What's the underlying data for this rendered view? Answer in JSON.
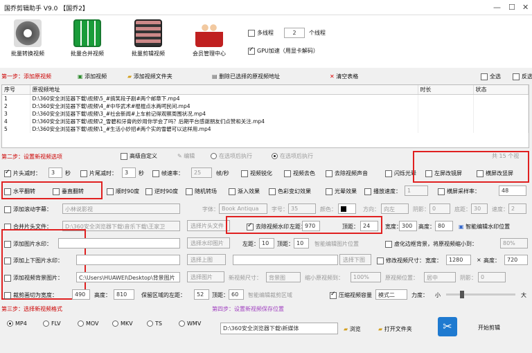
{
  "window": {
    "title": "国乔剪辑助手 V9.0 【国乔2】"
  },
  "toolbar": {
    "tools": [
      {
        "label": "批量转换视频"
      },
      {
        "label": "批量合并视频"
      },
      {
        "label": "批量剪辑视频"
      },
      {
        "label": "会员管理中心"
      }
    ],
    "multithread_label": "多线程",
    "thread_count": "2",
    "thread_unit": "个线程",
    "gpu_label": "GPU加速（用显卡解码）"
  },
  "step1": {
    "label": "第一步：添加原视频",
    "add_video": "添加视频",
    "add_folder": "添加视频文件夹",
    "delete_selected": "删除已选择的原视频地址",
    "clear_table": "清空表格",
    "select_all": "全选",
    "invert": "反选"
  },
  "table": {
    "columns": [
      "序号",
      "原视频地址",
      "时长",
      "状态"
    ],
    "rows": [
      {
        "n": "1",
        "path": "D:\\360安全浏览器下载\\视频\\5_#搞笑段子剧#两个邮章下.mp4"
      },
      {
        "n": "2",
        "path": "D:\\360安全浏览器下载\\视频\\4_#中华武术#棍棍点水两呵民间.mp4"
      },
      {
        "n": "3",
        "path": "D:\\360安全浏览器下载\\视频\\3_#社会新闻#上车前记得观察周围状况.mp4"
      },
      {
        "n": "4",
        "path": "D:\\360安全浏览器下载\\视频\\2_雪碧和牙膏的妙用你学会了吗？后期平台感谢朋友们点赞和关注.mp4"
      },
      {
        "n": "5",
        "path": "D:\\360安全浏览器下载\\视频\\1_#生活小妙招#两个实的雪碧可以这样用.mp4"
      }
    ],
    "count": "共 15 个视"
  },
  "step2": {
    "label": "第二步：设置新视频选项",
    "advanced": "高级自定义",
    "edit": "编辑",
    "sel_exec": "在选项后执行",
    "after_exec": "在选项后执行",
    "head_cut": "片头减时：",
    "head_val": "3",
    "sec": "秒",
    "tail_cut": "片尾减时：",
    "tail_val": "3",
    "sec2": "秒",
    "framerate": "帧速率：",
    "framerate_val": "25",
    "fps_unit": "帧/秒",
    "sharpen": "视频锐化",
    "color": "视频去色",
    "remove_audio": "去除视频声音",
    "flash": "闪烁光晕",
    "left_mirror": "左屏改镜屏",
    "right_mirror": "横屏改竖屏",
    "hflip": "水平翻转",
    "vflip": "垂直翻转",
    "rot90": "顺时90度",
    "rot90b": "逆时90度",
    "random_transition": "随机转场",
    "fade_in": "渐入效果",
    "color_shift": "色彩变幻效果",
    "light_effect": "光晕效果",
    "play_speed": "播放速度：",
    "speed_val": "1",
    "audio_rate": "横屏采样率：",
    "audio_rate_val": "48",
    "add_marquee": "添加滚动字幕：",
    "marquee_val": "小林说影视",
    "font": "字体：",
    "font_val": "Book Antiqua",
    "size": "字号：",
    "size_val": "35",
    "color_lbl": "颜色：",
    "direction": "方向：",
    "direction_val": "向左",
    "shadow": "阴影：",
    "shadow_val": "0",
    "bottom": "底距：",
    "bottom_val": "30",
    "speed2": "速度：",
    "speed2_val": "2",
    "merge_head": "合并片头文件：",
    "merge_head_val": "D:\\360安全浏览器下载\\音乐下载\\王家卫",
    "merge_select": "选择片头文件",
    "remove_watermark": "去除视频水印",
    "left": "左距：",
    "left_val": "970",
    "top": "顶距：",
    "top_val": "24",
    "width": "宽度：",
    "width_val": "300",
    "height": "高度：",
    "height_val": "80",
    "smart_edit": "智能编辑水印位置",
    "add_image_wm": "添加图片水印：",
    "select_wm": "选择水印图片",
    "left2": "左距：",
    "left2_val": "10",
    "top2": "顶距：",
    "top2_val": "10",
    "smart_img": "智能编辑图片位置",
    "blur_border": "虚化边框背景，将原视频缩小到：",
    "blur_val": "80%",
    "add_topbottom": "添加上下图片水印：",
    "select_top": "选择上图",
    "select_bottom": "选择下图",
    "resize": "修改视频尺寸：",
    "resize_w_lbl": "宽度：",
    "resize_w": "1280",
    "resize_h_lbl": "高度：",
    "resize_h": "720",
    "add_bg": "添加视频背景图片：",
    "bg_val": "C:\\Users\\HUAWEI\\Desktop\\背景图片",
    "select_image": "选择图片",
    "new_size": "新视频尺寸：",
    "new_size_val": "背景图",
    "shrink": "缩小原视频到：",
    "shrink_val": "100%",
    "orig_pos": "原视频位置：",
    "orig_pos_val": "居中",
    "shadow2": "阴影：",
    "shadow2_val": "0",
    "crop_height": "裁剪画切为宽度：",
    "crop_w": "490",
    "crop_h_lbl": "高度：",
    "crop_h": "810",
    "keep_area": "保留区域的左距：",
    "keep_left": "52",
    "keep_top": "顶距：",
    "keep_top_val": "60",
    "smart_crop": "智能编辑裁剪区域",
    "compress": "压缩视频容量",
    "compress_mode": "模式二",
    "strength": "力度：",
    "small": "小",
    "big": "大"
  },
  "step3": {
    "label": "第三步：选择新视频格式",
    "formats": [
      "MP4",
      "FLV",
      "MOV",
      "MKV",
      "TS",
      "WMV"
    ]
  },
  "step4": {
    "label": "第四步：设置新视频保存位置",
    "path": "D:\\360安全浏览器下载\\新媒体",
    "browse": "浏览",
    "open_folder": "打开文件夹",
    "start": "开始剪辑"
  }
}
